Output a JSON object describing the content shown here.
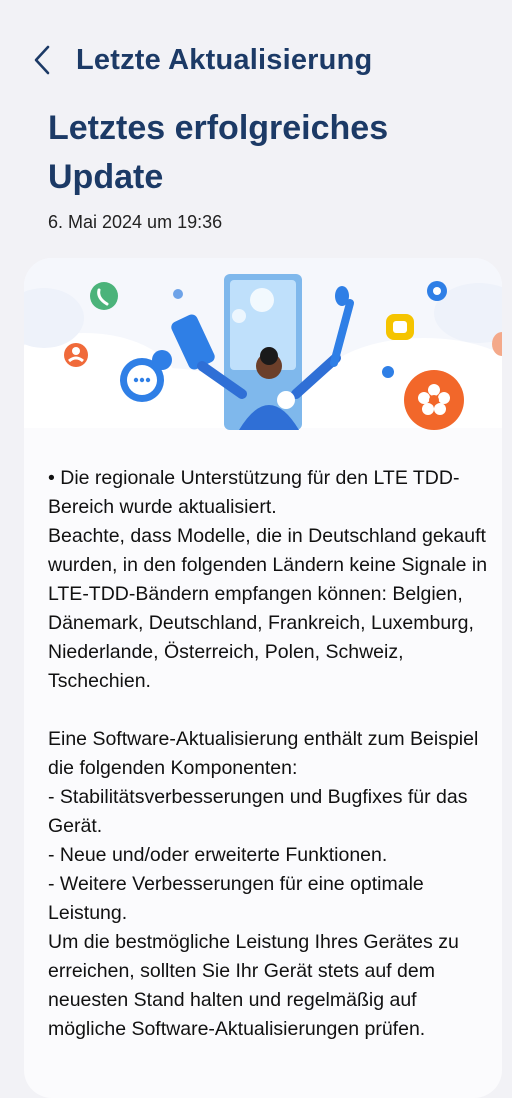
{
  "header": {
    "back_label": "Zurück",
    "title": "Letzte Aktualisierung"
  },
  "page": {
    "heading_line1": "Letztes erfolgreiches",
    "heading_line2": "Update",
    "date": "6. Mai 2024 um 19:36"
  },
  "banner": {
    "icons": [
      "phone-icon",
      "chat-icon",
      "flower-icon",
      "person-icon",
      "message-icon",
      "pen-icon",
      "phone-device-icon"
    ],
    "colors": {
      "green": "#4bb37a",
      "blue": "#2f7fe6",
      "orange": "#f2672a",
      "yellow": "#f5c400",
      "navy": "#1c3a66"
    }
  },
  "notes": {
    "para1": "• Die regionale Unterstützung für den LTE TDD-Bereich wurde aktualisiert.\nBeachte, dass Modelle, die in Deutschland gekauft wurden, in den folgenden Ländern keine Signale in LTE-TDD-Bändern empfangen können: Belgien, Dänemark, Deutschland, Frankreich, Luxemburg, Niederlande, Österreich, Polen, Schweiz, Tschechien.",
    "para2": "Eine Software-Aktualisierung enthält zum Beispiel die folgenden Komponenten:\n - Stabilitätsverbesserungen und Bugfixes für das Gerät.\n - Neue und/oder erweiterte Funktionen.\n - Weitere Verbesserungen für eine optimale Leistung.\nUm die bestmögliche Leistung Ihres Gerätes zu erreichen, sollten Sie Ihr Gerät stets auf dem neuesten Stand halten und regelmäßig auf mögliche Software-Aktualisierungen prüfen."
  }
}
